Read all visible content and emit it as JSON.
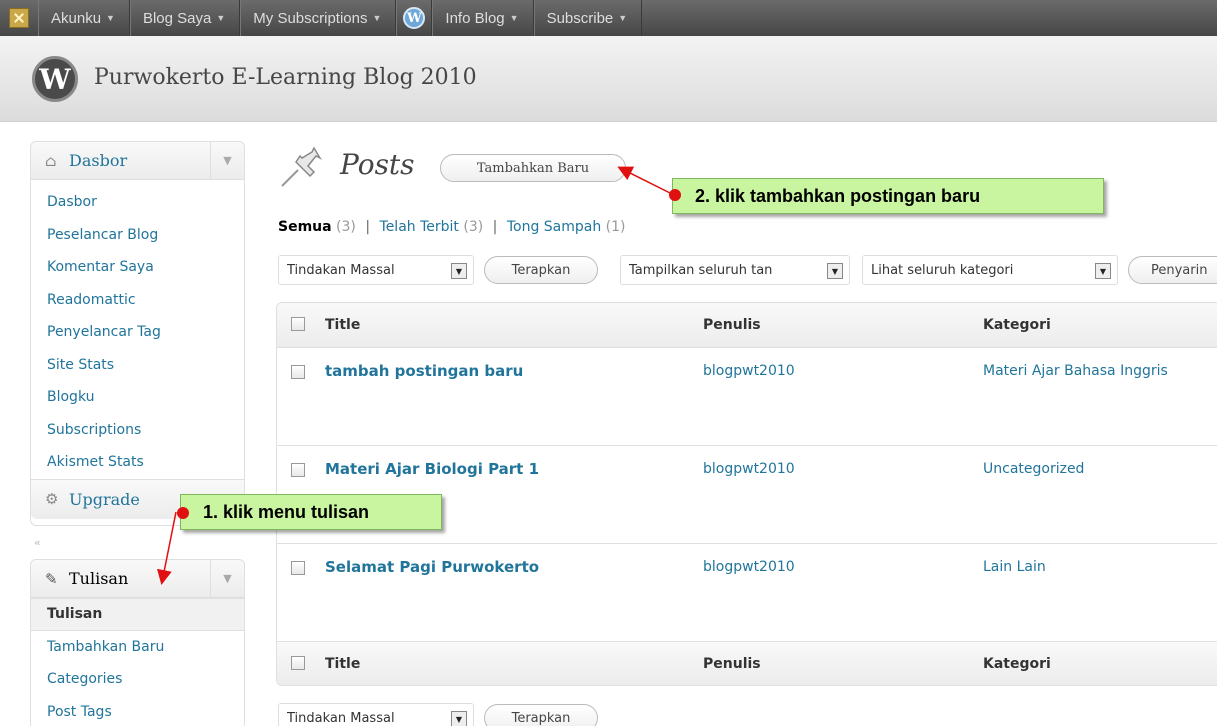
{
  "adminbar": {
    "items": [
      {
        "label": "Akunku",
        "caret": "▼"
      },
      {
        "label": "Blog Saya",
        "caret": "▼"
      },
      {
        "label": "My Subscriptions",
        "caret": "▼"
      },
      {
        "label": "Info Blog",
        "caret": "▼"
      },
      {
        "label": "Subscribe",
        "caret": "▼"
      }
    ],
    "wp_glyph": "W"
  },
  "site": {
    "title": "Purwokerto E-Learning Blog 2010",
    "logo_glyph": "W"
  },
  "sidebar": {
    "dashboard": {
      "head": "Dasbor",
      "items": [
        "Dasbor",
        "Peselancar Blog",
        "Komentar Saya",
        "Readomattic",
        "Penyelancar Tag",
        "Site Stats",
        "Blogku",
        "Subscriptions",
        "Akismet Stats"
      ],
      "upgrade": "Upgrade"
    },
    "collapse_glyph": "«",
    "posts": {
      "head": "Tulisan",
      "items": [
        "Tulisan",
        "Tambahkan Baru",
        "Categories",
        "Post Tags"
      ]
    },
    "toggle_glyph": "▼"
  },
  "main": {
    "title": "Posts",
    "add_new": "Tambahkan Baru",
    "filters": {
      "all": "Semua",
      "all_count": "(3)",
      "published": "Telah Terbit",
      "published_count": "(3)",
      "trash": "Tong Sampah",
      "trash_count": "(1)",
      "sep": "|"
    },
    "toolbar": {
      "bulk": "Tindakan Massal",
      "apply": "Terapkan",
      "dates": "Tampilkan seluruh tan",
      "categories": "Lihat seluruh kategori",
      "filter": "Penyarin"
    },
    "table": {
      "headers": {
        "title": "Title",
        "author": "Penulis",
        "category": "Kategori"
      },
      "rows": [
        {
          "title": "tambah postingan baru",
          "author": "blogpwt2010",
          "category": "Materi Ajar Bahasa Inggris"
        },
        {
          "title": "Materi Ajar Biologi Part 1",
          "author": "blogpwt2010",
          "category": "Uncategorized"
        },
        {
          "title": "Selamat Pagi Purwokerto",
          "author": "blogpwt2010",
          "category": "Lain Lain"
        }
      ]
    },
    "bottom_toolbar": {
      "bulk": "Tindakan Massal",
      "apply": "Terapkan"
    }
  },
  "annotations": {
    "step1": "1. klik menu tulisan",
    "step2": "2. klik tambahkan postingan baru"
  },
  "colors": {
    "link": "#21759b",
    "callout_bg": "#c9f5a0",
    "marker": "#e01010",
    "adminbar": "#464646"
  },
  "icons": [
    "home-icon",
    "gear-icon",
    "pushpin-icon",
    "wordpress-icon",
    "chevron-down-icon"
  ]
}
